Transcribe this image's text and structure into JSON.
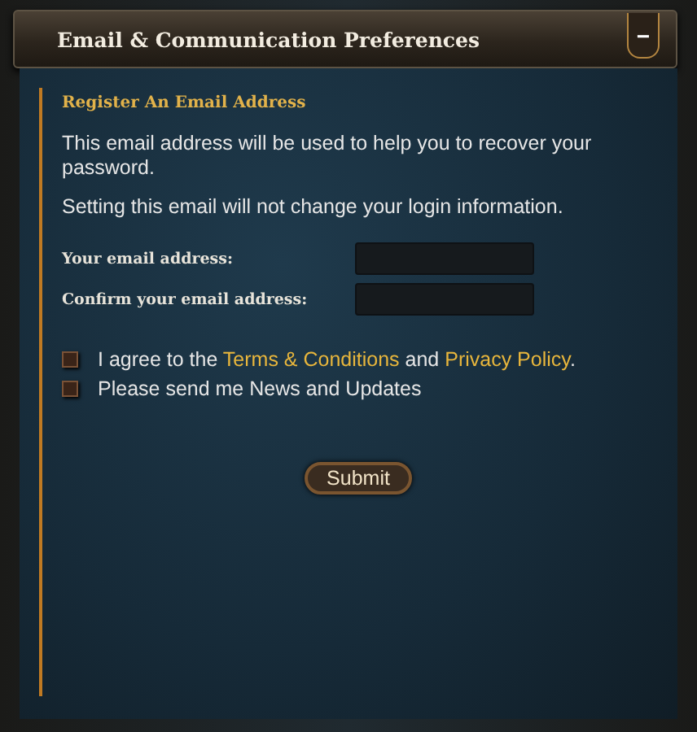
{
  "window": {
    "title": "Email & Communication Preferences",
    "collapse_icon": "−"
  },
  "section": {
    "heading": "Register An Email Address",
    "paragraphs": [
      "This email address will be used to help you to recover your password.",
      "Setting this email will not change your login information."
    ]
  },
  "fields": [
    {
      "label": "Your email address:"
    },
    {
      "label": "Confirm your email address:"
    }
  ],
  "options": [
    {
      "kind": "terms",
      "checked": false,
      "before": "I agree to the ",
      "link1": "Terms & Conditions",
      "middle": " and ",
      "link2": "Privacy Policy",
      "after": "."
    },
    {
      "kind": "plain",
      "checked": false,
      "text": "Please send me News and Updates"
    }
  ],
  "submit": "Submit"
}
